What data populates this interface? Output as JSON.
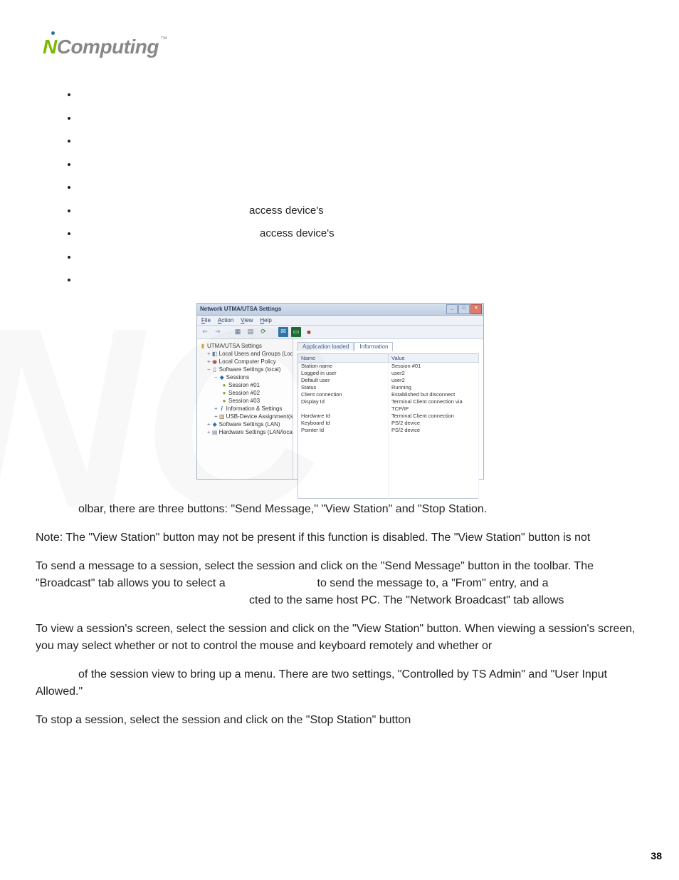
{
  "brand": {
    "name_n": "N",
    "name_rest": "Computing",
    "tm": "™"
  },
  "bullets": {
    "b0": "",
    "b1": "",
    "b2": "",
    "b3": "",
    "b4": "",
    "b5": "access device's",
    "b6": "access device's",
    "b7": "",
    "b8": ""
  },
  "screenshot": {
    "title": "Network UTMA/UTSA Settings",
    "menu": {
      "file": "File",
      "action": "Action",
      "view": "View",
      "help": "Help"
    },
    "tree": {
      "root": "UTMA/UTSA Settings",
      "users": "Local Users and Groups (Local)",
      "policy": "Local Computer Policy",
      "swset": "Software Settings (local)",
      "sessions": "Sessions",
      "sess1": "Session #01",
      "sess2": "Session #02",
      "sess3": "Session #03",
      "info": "Information & Settings",
      "usb": "USB-Device Assignment(s)",
      "swlan": "Software Settings (LAN)",
      "hw": "Hardware Settings (LAN/local)"
    },
    "tabs": {
      "loaded": "Application loaded",
      "info": "Information"
    },
    "columns": {
      "name": "Name",
      "value": "Value"
    },
    "rows": [
      {
        "name": "Station name",
        "value": "Session #01"
      },
      {
        "name": "Logged in user",
        "value": "user2"
      },
      {
        "name": "Default user",
        "value": "user2"
      },
      {
        "name": "Status",
        "value": "Running"
      },
      {
        "name": "Client connection",
        "value": "Established but disconnect"
      },
      {
        "name": "Display Id",
        "value": "Terminal Client connection via TCP/IP"
      },
      {
        "name": "Hardware Id",
        "value": "Terminal Client connection"
      },
      {
        "name": "Keyboard Id",
        "value": "PS/2 device"
      },
      {
        "name": "Pointer Id",
        "value": "PS/2 device"
      }
    ]
  },
  "paras": {
    "p1": "olbar, there are three buttons: \"Send Message,\" \"View Station\" and \"Stop Station.",
    "p2": "Note: The \"View Station\" button may not be present if this function is disabled. The \"View Station\" button is not",
    "p3a": "To send a message to a session, select the session and click on the \"Send Message\" button in the toolbar. The \"Broadcast\" tab allows you to select a",
    "p3gap": "                         ",
    "p3b": "to send the message to, a \"From\" entry, and a",
    "p3c": "cted to the same host PC. The \"Network Broadcast\" tab allows",
    "p4": "To view a session's screen, select the session and click on the \"View Station\" button. When viewing a session's screen, you may select whether or not to control the mouse and keyboard remotely and whether or",
    "p5a": "of the session view to bring up a menu. There are two settings, \"Controlled by TS Admin\" and \"User Input Allowed.\"",
    "p6": "To stop a session, select the session and click on the \"Stop Station\" button"
  },
  "page_number": "38",
  "watermark": "NC"
}
